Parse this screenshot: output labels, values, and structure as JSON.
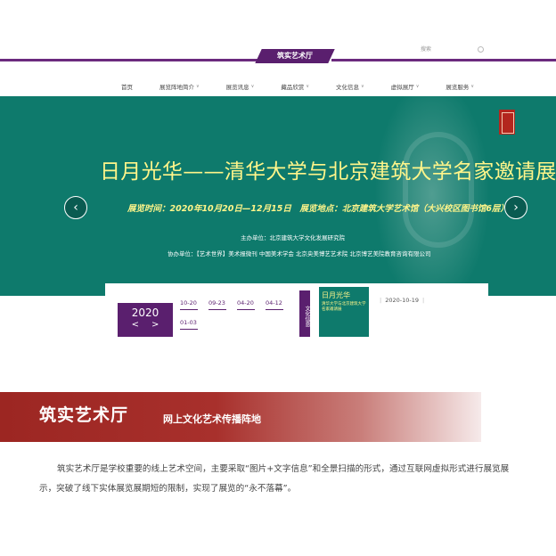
{
  "header": {
    "logo_text": "筑实艺术厅",
    "search_placeholder": "搜索"
  },
  "nav": [
    {
      "label": "首页",
      "has_menu": false
    },
    {
      "label": "展览阵地简介",
      "has_menu": true
    },
    {
      "label": "展览讯息",
      "has_menu": true
    },
    {
      "label": "藏品欣赏",
      "has_menu": true
    },
    {
      "label": "文化信息",
      "has_menu": true
    },
    {
      "label": "虚拟展厅",
      "has_menu": true
    },
    {
      "label": "展览服务",
      "has_menu": true
    }
  ],
  "banner": {
    "title": "日月光华——清华大学与北京建筑大学名家邀请展",
    "info": "展览时间：2020年10月20日—12月15日　展览地点：北京建筑大学艺术馆（大兴校区图书馆6层）",
    "organizer": "主办单位：北京建筑大学文化发展研究院",
    "co_organizer": "协办单位：【艺术世界】美术报微刊 中国美术学会 北京央美博艺艺术院 北京博艺美院教育咨询有限公司",
    "prev_icon": "chevron-left-icon",
    "next_icon": "chevron-right-icon",
    "colors": {
      "bg": "#0e7a6c",
      "title": "#fff58a"
    }
  },
  "news": {
    "year": "2020",
    "year_prev": "<",
    "year_next": ">",
    "dates": [
      "10-20",
      "09-23",
      "04-20",
      "04-12",
      "01-03"
    ],
    "tag": "文化信息",
    "thumb_title": "日月光华",
    "thumb_sub": "清华大学与北京建筑大学名家邀请展",
    "date": "2020-10-19"
  },
  "tagline": {
    "main": "筑实艺术厅",
    "sub": "网上文化艺术传播阵地"
  },
  "description": "筑实艺术厅是学校重要的线上艺术空间，主要采取“图片+文字信息”和全景扫描的形式，通过互联网虚拟形式进行展览展示，突破了线下实体展览展期短的限制，实现了展览的“永不落幕”。",
  "colors": {
    "brand": "#5a1f6e",
    "tagline": "#9c2622"
  }
}
